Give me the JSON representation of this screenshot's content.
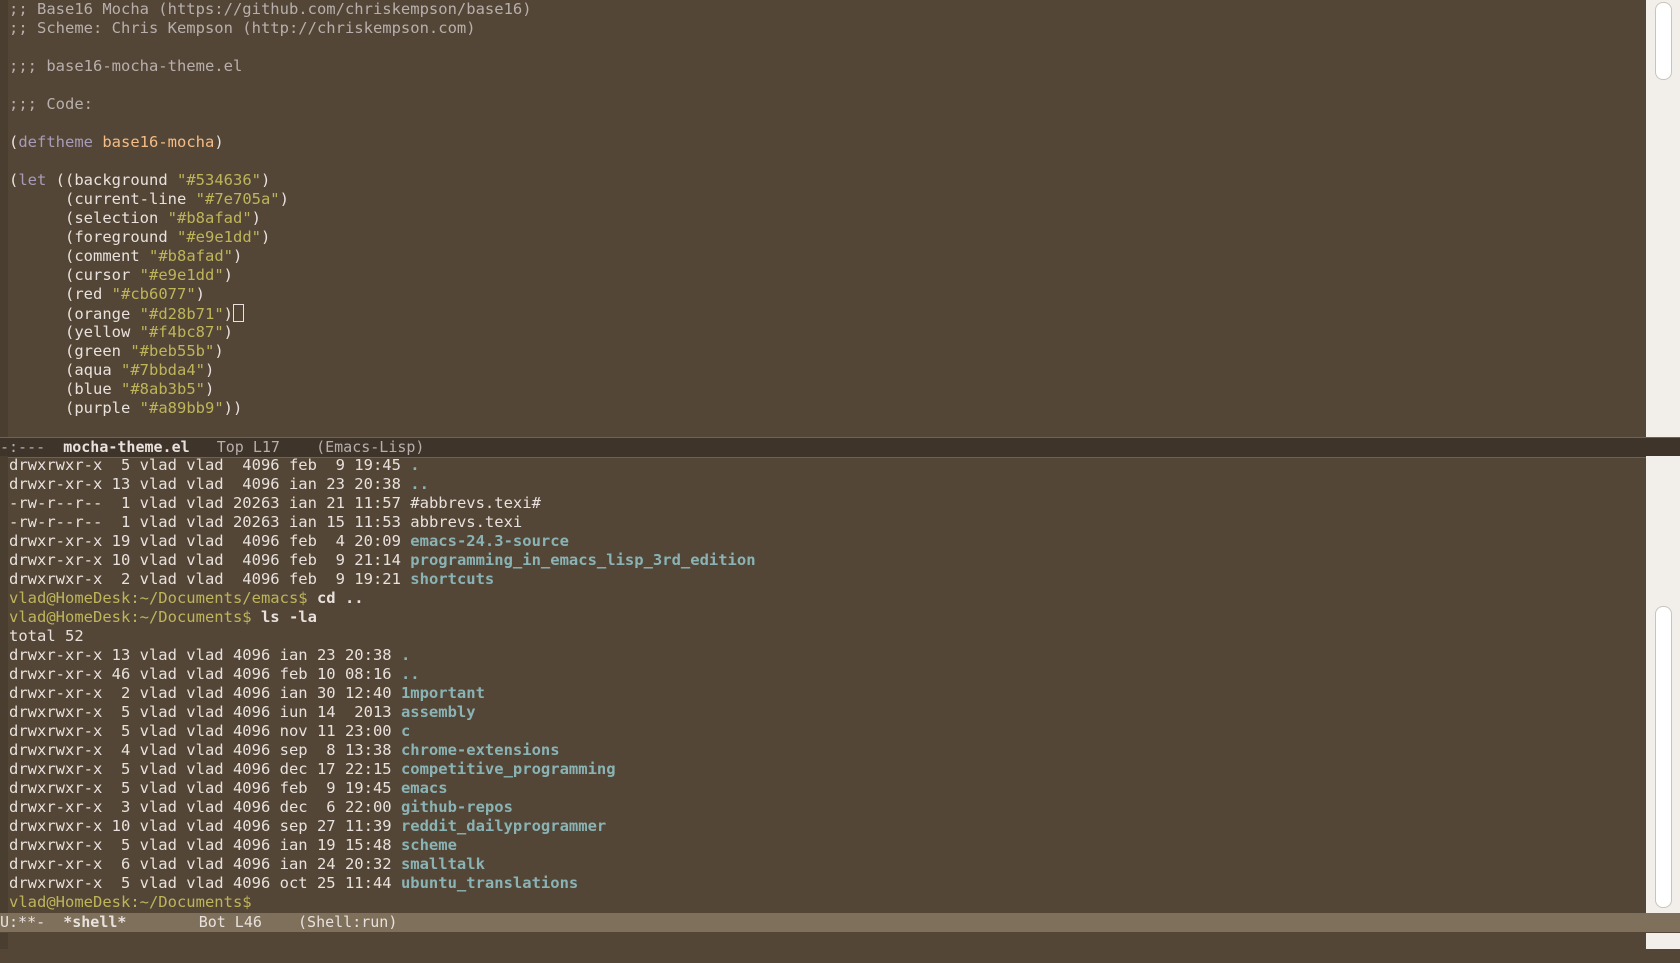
{
  "top_buffer": {
    "header_comments": [
      ";; Base16 Mocha (https://github.com/chriskempson/base16)",
      ";; Scheme: Chris Kempson (http://chriskempson.com)",
      ";;; base16-mocha-theme.el",
      ";;; Code:"
    ],
    "deftheme": {
      "kw": "deftheme",
      "name": "base16-mocha"
    },
    "let_kw": "let",
    "colors": [
      {
        "name": "background",
        "value": "\"#534636\""
      },
      {
        "name": "current-line",
        "value": "\"#7e705a\""
      },
      {
        "name": "selection",
        "value": "\"#b8afad\""
      },
      {
        "name": "foreground",
        "value": "\"#e9e1dd\""
      },
      {
        "name": "comment",
        "value": "\"#b8afad\""
      },
      {
        "name": "cursor",
        "value": "\"#e9e1dd\""
      },
      {
        "name": "red",
        "value": "\"#cb6077\""
      },
      {
        "name": "orange",
        "value": "\"#d28b71\""
      },
      {
        "name": "yellow",
        "value": "\"#f4bc87\""
      },
      {
        "name": "green",
        "value": "\"#beb55b\""
      },
      {
        "name": "aqua",
        "value": "\"#7bbda4\""
      },
      {
        "name": "blue",
        "value": "\"#8ab3b5\""
      },
      {
        "name": "purple",
        "value": "\"#a89bb9\""
      }
    ]
  },
  "modeline_top": {
    "state": "-:---",
    "buffer": "mocha-theme.el",
    "position": "Top L17",
    "mode": "(Emacs-Lisp)"
  },
  "shell": {
    "listing1": [
      {
        "meta": "drwxrwxr-x  5 vlad vlad  4096 feb  9 19:45 ",
        "name": ".",
        "dir": true
      },
      {
        "meta": "drwxr-xr-x 13 vlad vlad  4096 ian 23 20:38 ",
        "name": "..",
        "dir": true
      },
      {
        "meta": "-rw-r--r--  1 vlad vlad 20263 ian 21 11:57 ",
        "name": "#abbrevs.texi#",
        "dir": false
      },
      {
        "meta": "-rw-r--r--  1 vlad vlad 20263 ian 15 11:53 ",
        "name": "abbrevs.texi",
        "dir": false
      },
      {
        "meta": "drwxr-xr-x 19 vlad vlad  4096 feb  4 20:09 ",
        "name": "emacs-24.3-source",
        "dir": true
      },
      {
        "meta": "drwxr-xr-x 10 vlad vlad  4096 feb  9 21:14 ",
        "name": "programming_in_emacs_lisp_3rd_edition",
        "dir": true
      },
      {
        "meta": "drwxrwxr-x  2 vlad vlad  4096 feb  9 19:21 ",
        "name": "shortcuts",
        "dir": true
      }
    ],
    "cmd1": {
      "prompt": "vlad@HomeDesk:~/Documents/emacs$ ",
      "command": "cd .."
    },
    "cmd2": {
      "prompt": "vlad@HomeDesk:~/Documents$ ",
      "command": "ls -la"
    },
    "total": "total 52",
    "listing2": [
      {
        "meta": "drwxr-xr-x 13 vlad vlad 4096 ian 23 20:38 ",
        "name": ".",
        "dir": true
      },
      {
        "meta": "drwxr-xr-x 46 vlad vlad 4096 feb 10 08:16 ",
        "name": "..",
        "dir": true
      },
      {
        "meta": "drwxr-xr-x  2 vlad vlad 4096 ian 30 12:40 ",
        "name": "1mportant",
        "dir": true
      },
      {
        "meta": "drwxrwxr-x  5 vlad vlad 4096 iun 14  2013 ",
        "name": "assembly",
        "dir": true
      },
      {
        "meta": "drwxrwxr-x  5 vlad vlad 4096 nov 11 23:00 ",
        "name": "c",
        "dir": true
      },
      {
        "meta": "drwxrwxr-x  4 vlad vlad 4096 sep  8 13:38 ",
        "name": "chrome-extensions",
        "dir": true
      },
      {
        "meta": "drwxrwxr-x  5 vlad vlad 4096 dec 17 22:15 ",
        "name": "competitive_programming",
        "dir": true
      },
      {
        "meta": "drwxrwxr-x  5 vlad vlad 4096 feb  9 19:45 ",
        "name": "emacs",
        "dir": true
      },
      {
        "meta": "drwxr-xr-x  3 vlad vlad 4096 dec  6 22:00 ",
        "name": "github-repos",
        "dir": true
      },
      {
        "meta": "drwxrwxr-x 10 vlad vlad 4096 sep 27 11:39 ",
        "name": "reddit_dailyprogrammer",
        "dir": true
      },
      {
        "meta": "drwxrwxr-x  5 vlad vlad 4096 ian 19 15:48 ",
        "name": "scheme",
        "dir": true
      },
      {
        "meta": "drwxr-xr-x  6 vlad vlad 4096 ian 24 20:32 ",
        "name": "smalltalk",
        "dir": true
      },
      {
        "meta": "drwxrwxr-x  5 vlad vlad 4096 oct 25 11:44 ",
        "name": "ubuntu_translations",
        "dir": true
      }
    ],
    "final_prompt": "vlad@HomeDesk:~/Documents$"
  },
  "modeline_bottom": {
    "state": "U:**-",
    "buffer": "*shell*",
    "position": "Bot L46",
    "mode": "(Shell:run)"
  },
  "colors": {
    "background": "#534636",
    "current_line": "#7e705a",
    "comment": "#b8afad",
    "foreground": "#e9e1dd",
    "keyword": "#a89bb9",
    "function": "#f4bc87",
    "string": "#beb55b",
    "directory": "#8ab3b5"
  }
}
